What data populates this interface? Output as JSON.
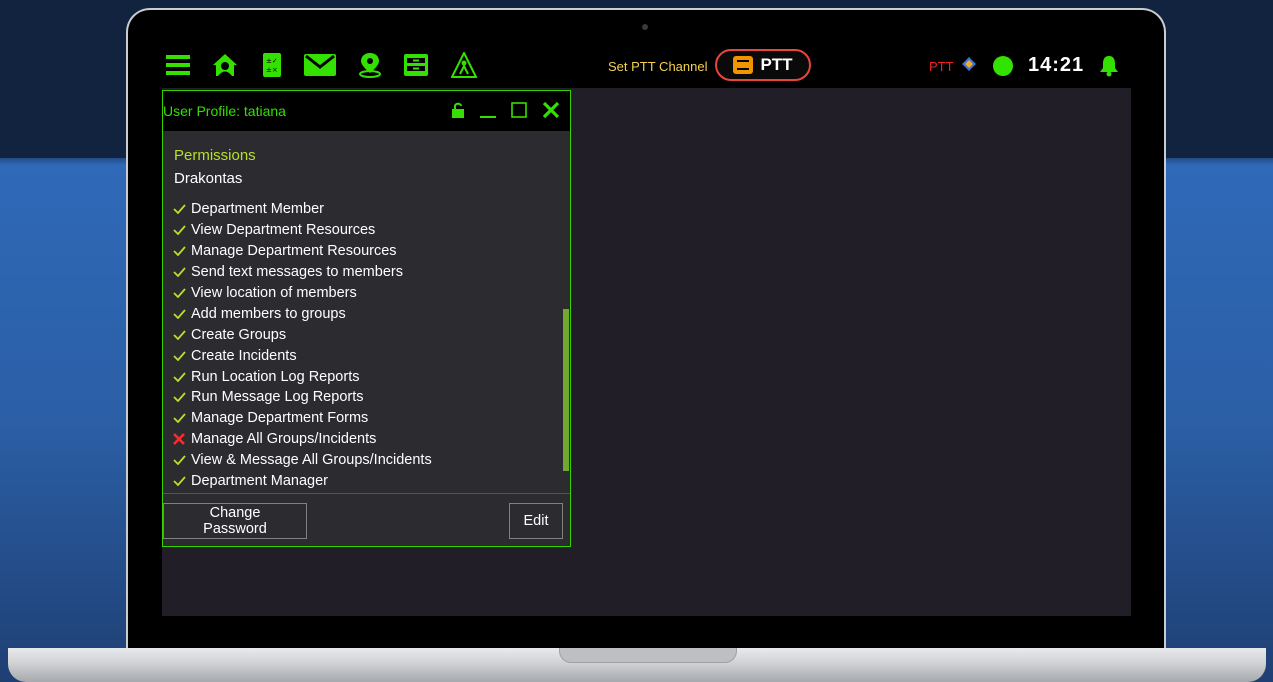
{
  "topbar": {
    "icons": [
      "menu-icon",
      "home-icon",
      "forms-icon",
      "mail-icon",
      "location-icon",
      "records-icon",
      "incident-icon"
    ],
    "ptt_channel_label": "Set PTT Channel",
    "ptt_button_label": "PTT",
    "status_ptt": "PTT",
    "clock": "14:21"
  },
  "panel": {
    "title": "User Profile: tatiana",
    "permissions_heading": "Permissions",
    "department": "Drakontas",
    "permissions": [
      {
        "label": "Department Member",
        "granted": true
      },
      {
        "label": "View Department Resources",
        "granted": true
      },
      {
        "label": "Manage Department Resources",
        "granted": true
      },
      {
        "label": "Send text messages to members",
        "granted": true
      },
      {
        "label": "View location of members",
        "granted": true
      },
      {
        "label": "Add members to groups",
        "granted": true
      },
      {
        "label": "Create Groups",
        "granted": true
      },
      {
        "label": "Create Incidents",
        "granted": true
      },
      {
        "label": "Run Location Log Reports",
        "granted": true
      },
      {
        "label": "Run Message Log Reports",
        "granted": true
      },
      {
        "label": "Manage Department Forms",
        "granted": true
      },
      {
        "label": "Manage All Groups/Incidents",
        "granted": false
      },
      {
        "label": "View & Message All Groups/Incidents",
        "granted": true
      },
      {
        "label": "Department Manager",
        "granted": true
      }
    ],
    "change_password_label": "Change Password",
    "edit_label": "Edit"
  },
  "colors": {
    "accent_green": "#33e000",
    "check_green": "#b8e02a",
    "deny_red": "#ff2a2a",
    "ptt_red": "#e8463b"
  }
}
